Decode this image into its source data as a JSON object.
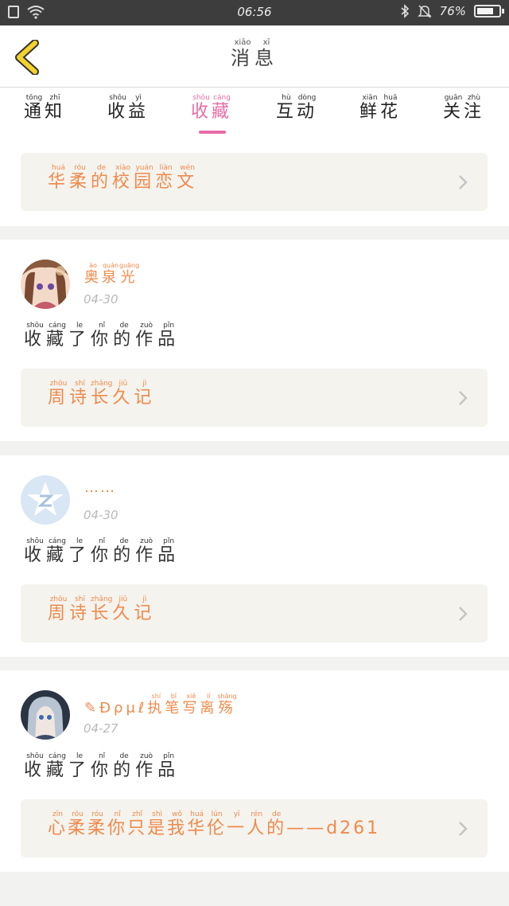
{
  "status_bar": {
    "time": "06:56",
    "battery_level": "76%",
    "battery_fraction": 0.76
  },
  "header": {
    "title_chars": [
      {
        "hanzi": "消",
        "pinyin": "xiāo"
      },
      {
        "hanzi": "息",
        "pinyin": "xī"
      }
    ]
  },
  "tabs": [
    {
      "chars": [
        {
          "hanzi": "通",
          "pinyin": "tōng"
        },
        {
          "hanzi": "知",
          "pinyin": "zhī"
        }
      ],
      "active": false
    },
    {
      "chars": [
        {
          "hanzi": "收",
          "pinyin": "shōu"
        },
        {
          "hanzi": "益",
          "pinyin": "yì"
        }
      ],
      "active": false
    },
    {
      "chars": [
        {
          "hanzi": "收",
          "pinyin": "shōu"
        },
        {
          "hanzi": "藏",
          "pinyin": "cáng"
        }
      ],
      "active": true
    },
    {
      "chars": [
        {
          "hanzi": "互",
          "pinyin": "hù"
        },
        {
          "hanzi": "动",
          "pinyin": "dòng"
        }
      ],
      "active": false
    },
    {
      "chars": [
        {
          "hanzi": "鲜",
          "pinyin": "xiān"
        },
        {
          "hanzi": "花",
          "pinyin": "huā"
        }
      ],
      "active": false
    },
    {
      "chars": [
        {
          "hanzi": "关",
          "pinyin": "guān"
        },
        {
          "hanzi": "注",
          "pinyin": "zhù"
        }
      ],
      "active": false
    }
  ],
  "top_link": {
    "chars": [
      {
        "hanzi": "华",
        "pinyin": "huá"
      },
      {
        "hanzi": "柔",
        "pinyin": "róu"
      },
      {
        "hanzi": "的",
        "pinyin": "de"
      },
      {
        "hanzi": "校",
        "pinyin": "xiào"
      },
      {
        "hanzi": "园",
        "pinyin": "yuán"
      },
      {
        "hanzi": "恋",
        "pinyin": "liàn"
      },
      {
        "hanzi": "文",
        "pinyin": "wén"
      }
    ]
  },
  "notifications": [
    {
      "user_chars": [
        {
          "hanzi": "奥",
          "pinyin": "ào"
        },
        {
          "hanzi": "泉",
          "pinyin": "quán"
        },
        {
          "hanzi": "光",
          "pinyin": "guāng"
        }
      ],
      "user_prefix": "",
      "user_plain": "",
      "date": "04-30",
      "avatar": "anime-girl-avatar",
      "action_chars": [
        {
          "hanzi": "收",
          "pinyin": "shōu"
        },
        {
          "hanzi": "藏",
          "pinyin": "cáng"
        },
        {
          "hanzi": "了",
          "pinyin": "le"
        },
        {
          "hanzi": "你",
          "pinyin": "nǐ"
        },
        {
          "hanzi": "的",
          "pinyin": "de"
        },
        {
          "hanzi": "作",
          "pinyin": "zuò"
        },
        {
          "hanzi": "品",
          "pinyin": "pǐn"
        }
      ],
      "work_chars": [
        {
          "hanzi": "周",
          "pinyin": "zhōu"
        },
        {
          "hanzi": "诗",
          "pinyin": "shī"
        },
        {
          "hanzi": "长",
          "pinyin": "zhǎng"
        },
        {
          "hanzi": "久",
          "pinyin": "jiǔ"
        },
        {
          "hanzi": "记",
          "pinyin": "jì"
        }
      ],
      "work_suffix": ""
    },
    {
      "user_chars": [],
      "user_prefix": "",
      "user_plain": "……",
      "date": "04-30",
      "avatar": "qzone-star-avatar",
      "action_chars": [
        {
          "hanzi": "收",
          "pinyin": "shōu"
        },
        {
          "hanzi": "藏",
          "pinyin": "cáng"
        },
        {
          "hanzi": "了",
          "pinyin": "le"
        },
        {
          "hanzi": "你",
          "pinyin": "nǐ"
        },
        {
          "hanzi": "的",
          "pinyin": "de"
        },
        {
          "hanzi": "作",
          "pinyin": "zuò"
        },
        {
          "hanzi": "品",
          "pinyin": "pǐn"
        }
      ],
      "work_chars": [
        {
          "hanzi": "周",
          "pinyin": "zhōu"
        },
        {
          "hanzi": "诗",
          "pinyin": "shī"
        },
        {
          "hanzi": "长",
          "pinyin": "zhǎng"
        },
        {
          "hanzi": "久",
          "pinyin": "jiǔ"
        },
        {
          "hanzi": "记",
          "pinyin": "jì"
        }
      ],
      "work_suffix": ""
    },
    {
      "user_chars": [
        {
          "hanzi": "执",
          "pinyin": "shí"
        },
        {
          "hanzi": "笔",
          "pinyin": "bǐ"
        },
        {
          "hanzi": "写",
          "pinyin": "xiě"
        },
        {
          "hanzi": "离",
          "pinyin": "lí"
        },
        {
          "hanzi": "殇",
          "pinyin": "shāng"
        }
      ],
      "user_prefix": "✎Ðρμℓ",
      "user_plain": "",
      "date": "04-27",
      "avatar": "anime-silver-hair-avatar",
      "action_chars": [
        {
          "hanzi": "收",
          "pinyin": "shōu"
        },
        {
          "hanzi": "藏",
          "pinyin": "cáng"
        },
        {
          "hanzi": "了",
          "pinyin": "le"
        },
        {
          "hanzi": "你",
          "pinyin": "nǐ"
        },
        {
          "hanzi": "的",
          "pinyin": "de"
        },
        {
          "hanzi": "作",
          "pinyin": "zuò"
        },
        {
          "hanzi": "品",
          "pinyin": "pǐn"
        }
      ],
      "work_chars": [
        {
          "hanzi": "心",
          "pinyin": "zīn"
        },
        {
          "hanzi": "柔",
          "pinyin": "róu"
        },
        {
          "hanzi": "柔",
          "pinyin": "róu"
        },
        {
          "hanzi": "你",
          "pinyin": "nǐ"
        },
        {
          "hanzi": "只",
          "pinyin": "zhǐ"
        },
        {
          "hanzi": "是",
          "pinyin": "shì"
        },
        {
          "hanzi": "我",
          "pinyin": "wǒ"
        },
        {
          "hanzi": "华",
          "pinyin": "huá"
        },
        {
          "hanzi": "伦",
          "pinyin": "lún"
        },
        {
          "hanzi": "一",
          "pinyin": "yī"
        },
        {
          "hanzi": "人",
          "pinyin": "rén"
        },
        {
          "hanzi": "的",
          "pinyin": "de"
        }
      ],
      "work_suffix": "——d261"
    }
  ],
  "colors": {
    "accent_pink": "#e76ca6",
    "orange_text": "#f08a4b",
    "back_arrow": "#f5d22a"
  }
}
